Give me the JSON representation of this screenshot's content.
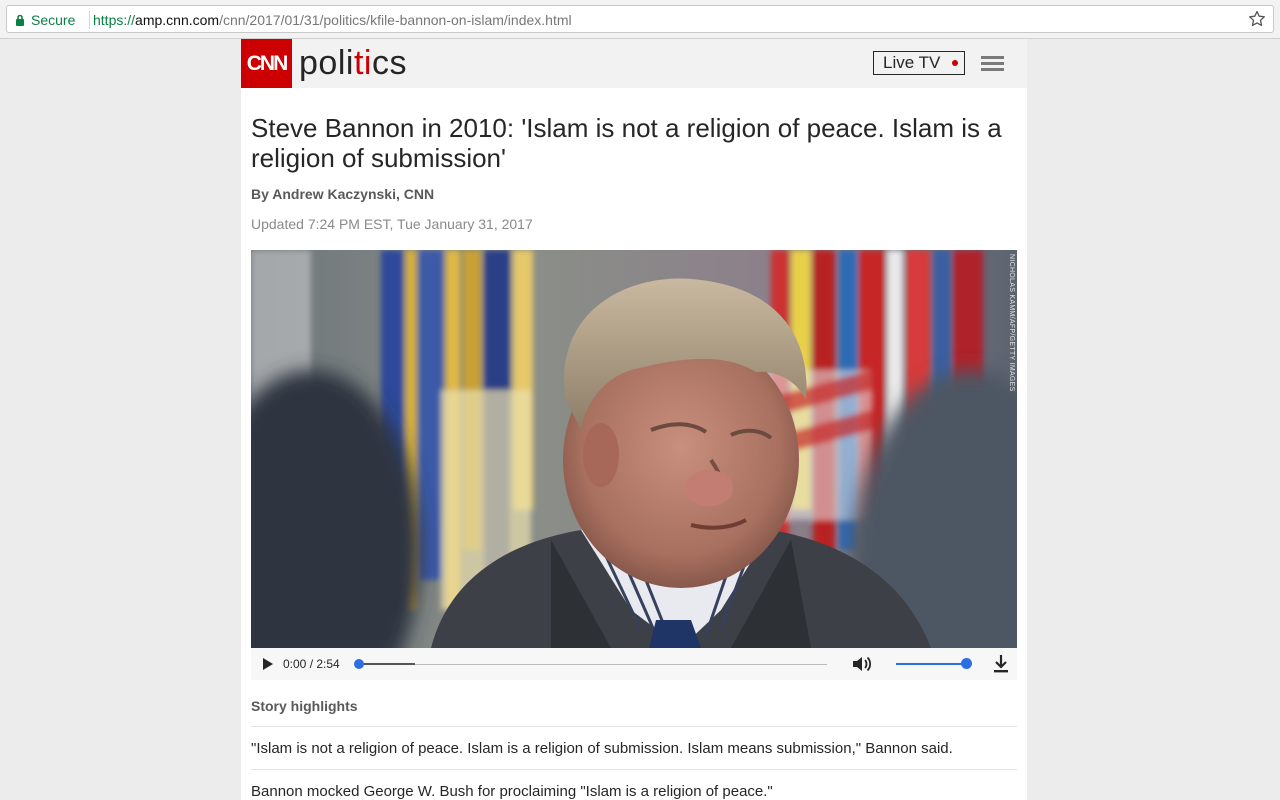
{
  "browser": {
    "secure_label": "Secure",
    "url_scheme": "https://",
    "url_host": "amp.cnn.com",
    "url_path": "/cnn/2017/01/31/politics/kfile-bannon-on-islam/index.html"
  },
  "header": {
    "logo_text": "CNN",
    "section_part1": "poli",
    "section_part2": "ti",
    "section_part3": "cs",
    "live_tv_label": "Live TV"
  },
  "article": {
    "headline": "Steve Bannon in 2010: 'Islam is not a religion of peace. Islam is a religion of submission'",
    "byline": "By Andrew Kaczynski, CNN",
    "updated": "Updated 7:24 PM EST, Tue January 31, 2017",
    "photo_credit": "NICHOLAS KAMM/AFP/GETTY IMAGES"
  },
  "player": {
    "time": "0:00 / 2:54",
    "progress": 0,
    "buffered": 0.12,
    "volume": 1.0
  },
  "highlights": {
    "title": "Story highlights",
    "items": [
      "\"Islam is not a religion of peace. Islam is a religion of submission. Islam means submission,\" Bannon said.",
      "Bannon mocked George W. Bush for proclaiming \"Islam is a religion of peace.\""
    ]
  },
  "colors": {
    "cnn_red": "#cc0000",
    "secure_green": "#0b8043",
    "player_blue": "#2d6fe0"
  }
}
